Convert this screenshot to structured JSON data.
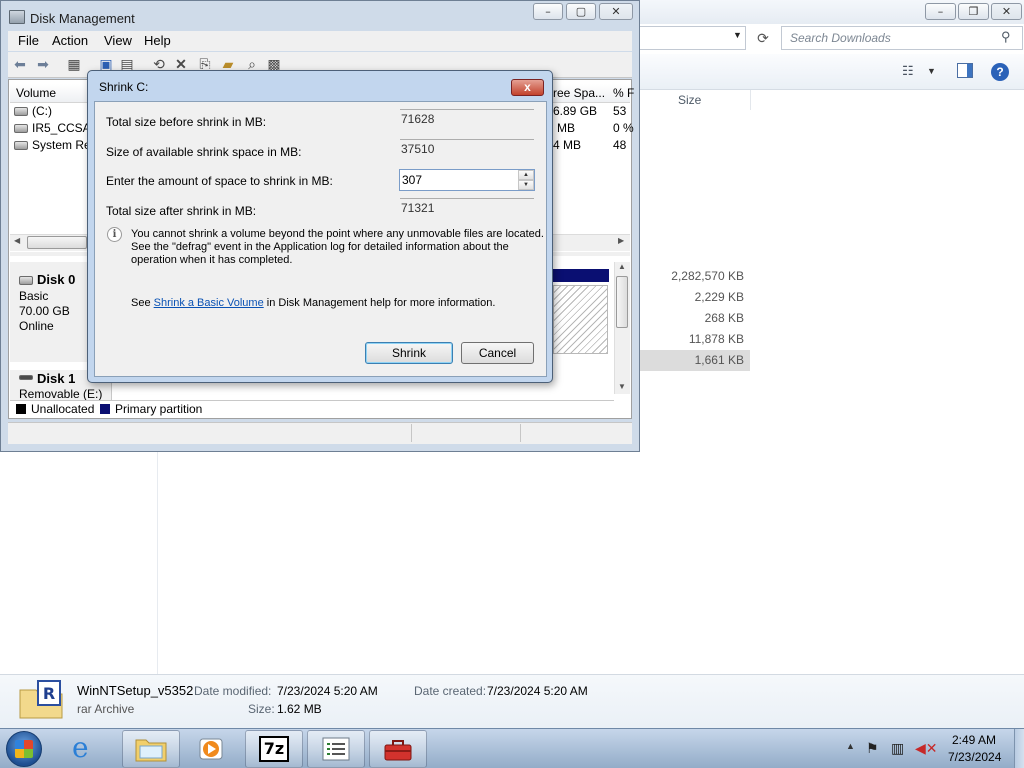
{
  "explorer": {
    "search_placeholder": "Search Downloads",
    "size_header": "Size",
    "sizes": [
      "2,282,570 KB",
      "2,229 KB",
      "268 KB",
      "11,878 KB",
      "1,661 KB"
    ],
    "details": {
      "file_name": "WinNTSetup_v5352",
      "file_type": "rar Archive",
      "modified_label": "Date modified:",
      "modified_value": "7/23/2024 5:20 AM",
      "created_label": "Date created:",
      "created_value": "7/23/2024 5:20 AM",
      "size_label": "Size:",
      "size_value": "1.62 MB"
    }
  },
  "disk_management": {
    "title": "Disk Management",
    "menu": [
      "File",
      "Action",
      "View",
      "Help"
    ],
    "volume_header": "Volume",
    "free_header": "ree Spa...",
    "pct_header": "% F",
    "volumes": [
      {
        "name": "(C:)",
        "free": "6.89 GB",
        "pct": "53"
      },
      {
        "name": "IR5_CCSA_",
        "free": "MB",
        "pct": "0 %"
      },
      {
        "name": "System Res",
        "free": "4 MB",
        "pct": "48"
      }
    ],
    "disk0": {
      "name": "Disk 0",
      "type": "Basic",
      "size": "70.00 GB",
      "status": "Online"
    },
    "disk1": {
      "name": "Disk 1",
      "type": "Removable (E:)"
    },
    "legend": {
      "unallocated": "Unallocated",
      "primary": "Primary partition"
    },
    "colors": {
      "unallocated": "#000000",
      "primary": "#0a0f72"
    }
  },
  "shrink_dialog": {
    "title": "Shrink C:",
    "close_glyph": "x",
    "total_before_label": "Total size before shrink in MB:",
    "total_before_value": "71628",
    "available_label": "Size of available shrink space in MB:",
    "available_value": "37510",
    "amount_label": "Enter the amount of space to shrink in MB:",
    "amount_value": "307",
    "total_after_label": "Total size after shrink in MB:",
    "total_after_value": "71321",
    "info_line1": "You cannot shrink a volume beyond the point where any unmovable files are located.",
    "info_line2": "See the \"defrag\" event in the Application log for detailed information about the",
    "info_line3": "operation when it has completed.",
    "see_prefix": "See ",
    "see_link": "Shrink a Basic Volume",
    "see_suffix": " in Disk Management help for more information.",
    "shrink_button": "Shrink",
    "cancel_button": "Cancel"
  },
  "taskbar": {
    "time": "2:49 AM",
    "date": "7/23/2024",
    "icons": [
      "start-orb-icon",
      "internet-explorer-icon",
      "file-explorer-icon",
      "media-player-icon",
      "7zip-icon",
      "task-list-icon",
      "toolbox-icon"
    ]
  }
}
